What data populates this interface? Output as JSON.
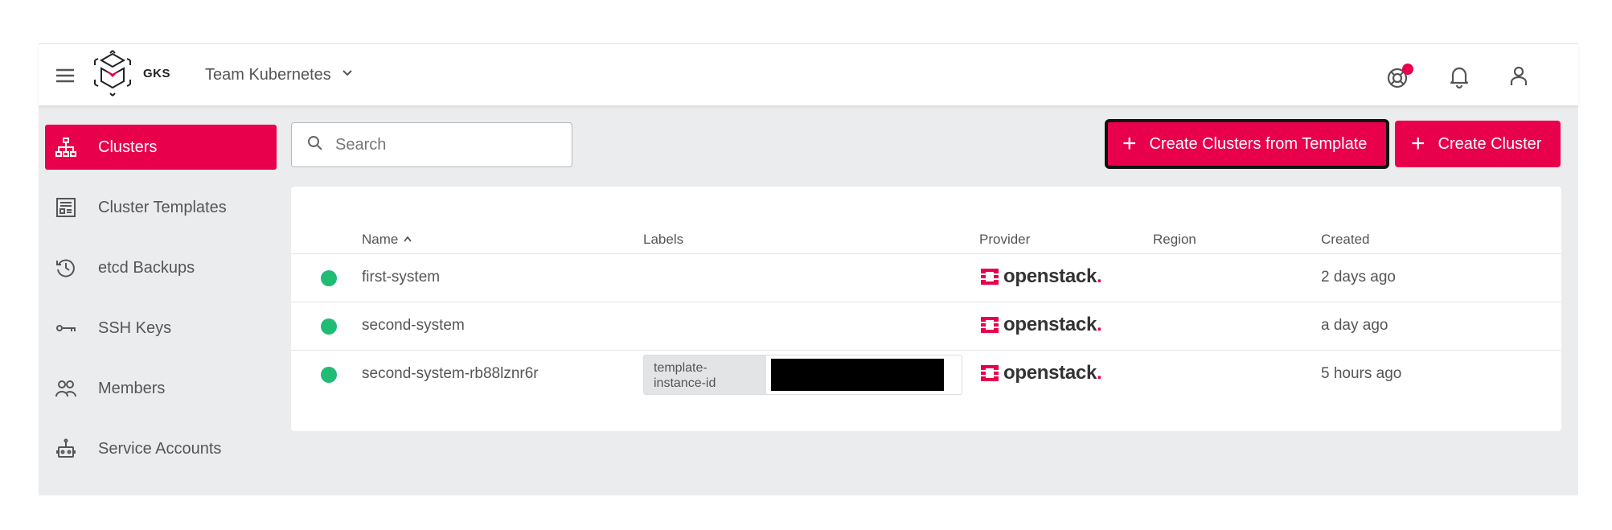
{
  "app": {
    "logo_text": "GKS",
    "project": "Team Kubernetes"
  },
  "sidebar": {
    "items": [
      {
        "label": "Clusters",
        "icon": "sitemap-icon",
        "active": true
      },
      {
        "label": "Cluster Templates",
        "icon": "template-icon",
        "active": false
      },
      {
        "label": "etcd Backups",
        "icon": "history-icon",
        "active": false
      },
      {
        "label": "SSH Keys",
        "icon": "key-icon",
        "active": false
      },
      {
        "label": "Members",
        "icon": "users-icon",
        "active": false
      },
      {
        "label": "Service Accounts",
        "icon": "robot-icon",
        "active": false
      }
    ]
  },
  "search": {
    "placeholder": "Search"
  },
  "actions": {
    "create_from_template": "Create Clusters from Template",
    "create_cluster": "Create Cluster"
  },
  "table": {
    "columns": {
      "name": "Name",
      "labels": "Labels",
      "provider": "Provider",
      "region": "Region",
      "created": "Created"
    },
    "rows": [
      {
        "name": "first-system",
        "provider": "openstack",
        "region": "",
        "created": "2 days ago",
        "status": "running"
      },
      {
        "name": "second-system",
        "provider": "openstack",
        "region": "",
        "created": "a day ago",
        "status": "running"
      },
      {
        "name": "second-system-rb88lznr6r",
        "label_key": "template-instance-id",
        "provider": "openstack",
        "region": "",
        "created": "5 hours ago",
        "status": "running"
      }
    ]
  },
  "colors": {
    "accent": "#e8004c",
    "status_ok": "#1fbc74",
    "background": "#ebeced"
  }
}
